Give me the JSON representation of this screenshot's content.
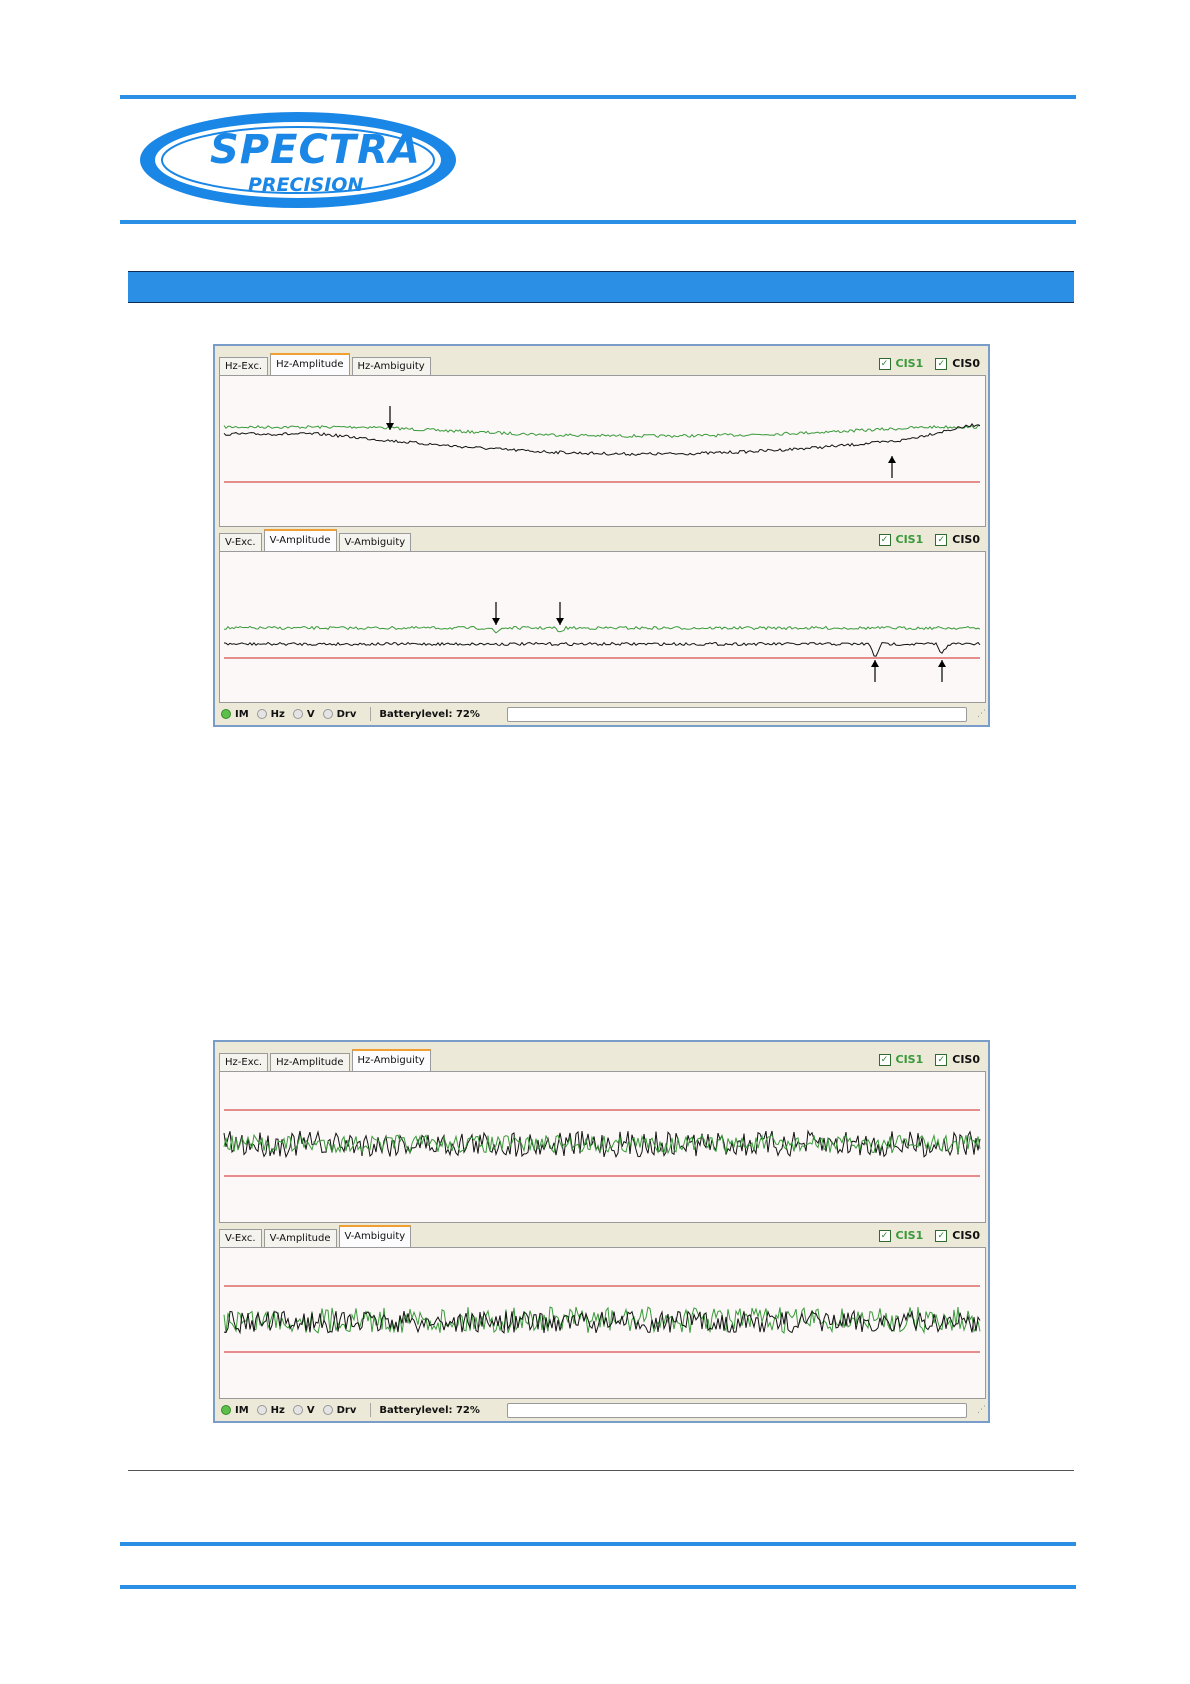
{
  "header": {
    "logo_top": "SPECTRA",
    "logo_bottom": "PRECISION"
  },
  "section_title": "",
  "screenshots": [
    {
      "top_panel": {
        "tabs": [
          "Hz-Exc.",
          "Hz-Amplitude",
          "Hz-Ambiguity"
        ],
        "active_tab": 1,
        "checks": [
          {
            "label": "CIS1",
            "checked": true
          },
          {
            "label": "CIS0",
            "checked": true
          }
        ]
      },
      "bottom_panel": {
        "tabs": [
          "V-Exc.",
          "V-Amplitude",
          "V-Ambiguity"
        ],
        "active_tab": 1,
        "checks": [
          {
            "label": "CIS1",
            "checked": true
          },
          {
            "label": "CIS0",
            "checked": true
          }
        ]
      },
      "status": {
        "indicators": [
          "IM",
          "Hz",
          "V",
          "Drv"
        ],
        "active_indicator": "IM",
        "battery": "Batterylevel: 72%"
      }
    },
    {
      "top_panel": {
        "tabs": [
          "Hz-Exc.",
          "Hz-Amplitude",
          "Hz-Ambiguity"
        ],
        "active_tab": 2,
        "checks": [
          {
            "label": "CIS1",
            "checked": true
          },
          {
            "label": "CIS0",
            "checked": true
          }
        ]
      },
      "bottom_panel": {
        "tabs": [
          "V-Exc.",
          "V-Amplitude",
          "V-Ambiguity"
        ],
        "active_tab": 2,
        "checks": [
          {
            "label": "CIS1",
            "checked": true
          },
          {
            "label": "CIS0",
            "checked": true
          }
        ]
      },
      "status": {
        "indicators": [
          "IM",
          "Hz",
          "V",
          "Drv"
        ],
        "active_indicator": "IM",
        "battery": "Batterylevel: 72%"
      }
    }
  ],
  "colors": {
    "accent": "#2b8fe6",
    "cis1": "#3a9a3a",
    "cis0": "#111111",
    "limit": "#cc2222"
  }
}
